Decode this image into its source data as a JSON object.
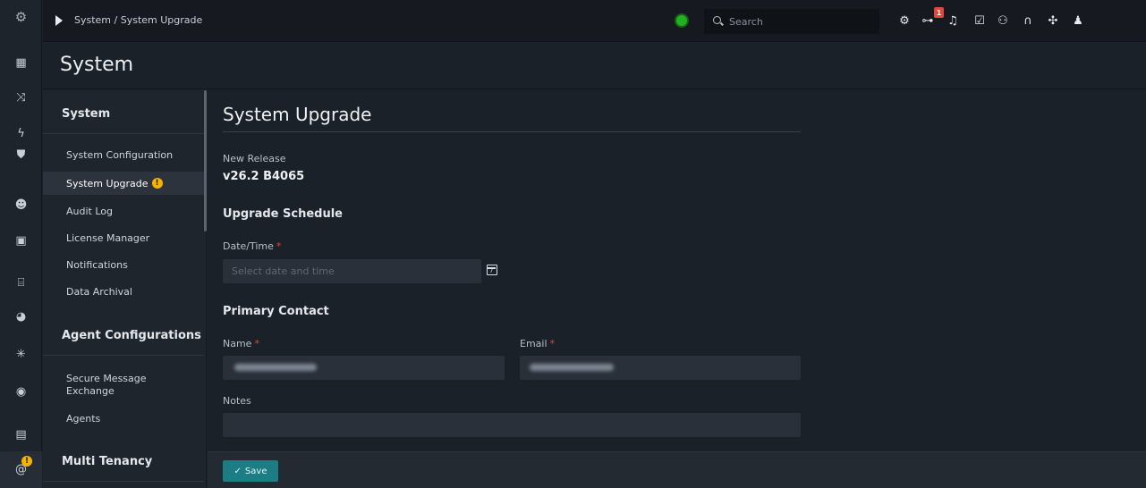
{
  "topbar": {
    "breadcrumb": "System / System Upgrade",
    "search_placeholder": "Search",
    "notification_count": "1",
    "icons": [
      "settings-icon",
      "hierarchy-icon",
      "bell-icon",
      "checklist-icon",
      "user-group-icon",
      "headset-icon",
      "integrations-icon",
      "user-icon"
    ]
  },
  "rail": {
    "icons": [
      "logo-icon",
      "dashboard-icon",
      "shuffle-icon",
      "bolt-icon",
      "shield-icon",
      "users-icon",
      "report-icon",
      "briefcase-icon",
      "pie-chart-icon",
      "bug-icon",
      "target-icon",
      "trash-icon",
      "at-icon"
    ],
    "badge": "!"
  },
  "header": {
    "title": "System"
  },
  "subnav": {
    "sections": [
      {
        "label": "System"
      },
      {
        "label": "Agent Configurations"
      },
      {
        "label": "Multi Tenancy"
      }
    ],
    "items": [
      {
        "label": "System Configuration"
      },
      {
        "label": "System Upgrade"
      },
      {
        "label": "Audit Log"
      },
      {
        "label": "License Manager"
      },
      {
        "label": "Notifications"
      },
      {
        "label": "Data Archival"
      },
      {
        "label": "Secure Message Exchange"
      },
      {
        "label": "Agents"
      }
    ],
    "warning_badge": "!"
  },
  "content": {
    "title": "System Upgrade",
    "new_release_label": "New Release",
    "new_release_value": "v26.2 B4065",
    "schedule_heading": "Upgrade Schedule",
    "datetime_label": "Date/Time",
    "datetime_placeholder": "Select date and time",
    "contact_heading": "Primary Contact",
    "name_label": "Name",
    "email_label": "Email",
    "notes_label": "Notes",
    "required_mark": "*"
  },
  "footer": {
    "save_label": "Save"
  },
  "colors": {
    "accent": "#1c7e84",
    "warning": "#f4b400",
    "danger": "#e0463c",
    "status_ok": "#21b21f"
  }
}
